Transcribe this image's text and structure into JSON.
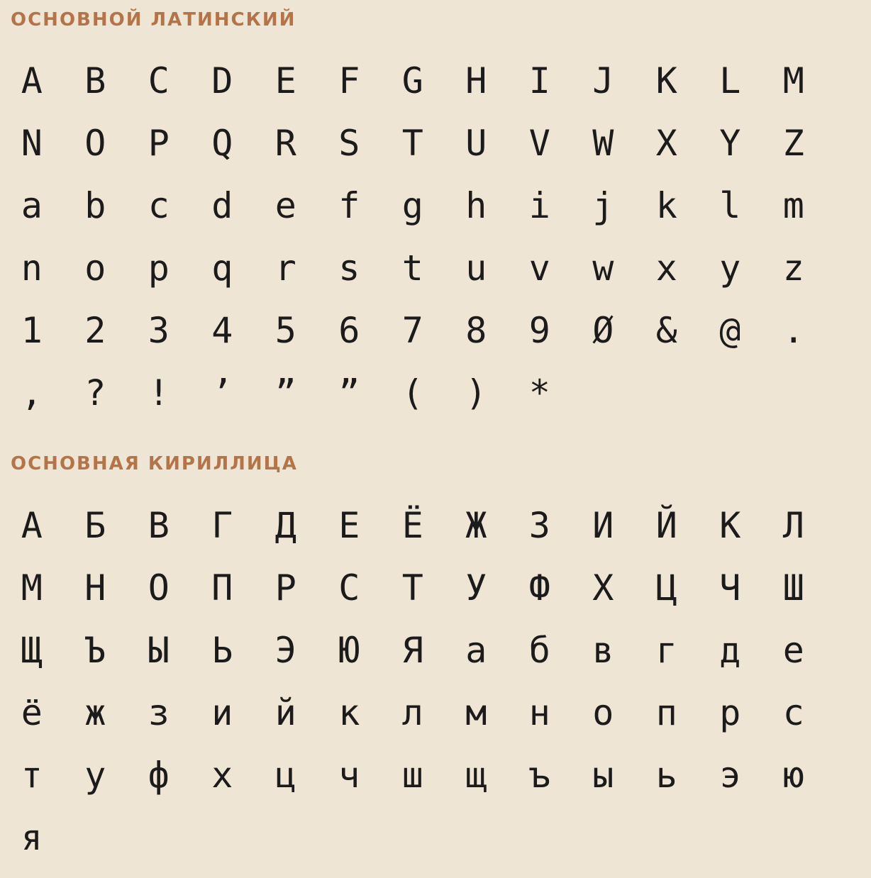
{
  "latin": {
    "title": "ОСНОВНОЙ ЛАТИНСКИЙ",
    "glyphs": [
      "A",
      "B",
      "C",
      "D",
      "E",
      "F",
      "G",
      "H",
      "I",
      "J",
      "K",
      "L",
      "M",
      "N",
      "O",
      "P",
      "Q",
      "R",
      "S",
      "T",
      "U",
      "V",
      "W",
      "X",
      "Y",
      "Z",
      "a",
      "b",
      "c",
      "d",
      "e",
      "f",
      "g",
      "h",
      "i",
      "j",
      "k",
      "l",
      "m",
      "n",
      "o",
      "p",
      "q",
      "r",
      "s",
      "t",
      "u",
      "v",
      "w",
      "x",
      "y",
      "z",
      "1",
      "2",
      "3",
      "4",
      "5",
      "6",
      "7",
      "8",
      "9",
      "Ø",
      "&",
      "@",
      ".",
      ",",
      "?",
      "!",
      "’",
      "”",
      "”",
      "(",
      ")",
      "*"
    ]
  },
  "cyrillic": {
    "title": "ОСНОВНАЯ КИРИЛЛИЦА",
    "glyphs": [
      "А",
      "Б",
      "В",
      "Г",
      "Д",
      "Е",
      "Ё",
      "Ж",
      "З",
      "И",
      "Й",
      "К",
      "Л",
      "М",
      "Н",
      "О",
      "П",
      "Р",
      "С",
      "Т",
      "У",
      "Ф",
      "Х",
      "Ц",
      "Ч",
      "Ш",
      "Щ",
      "Ъ",
      "Ы",
      "Ь",
      "Э",
      "Ю",
      "Я",
      "а",
      "б",
      "в",
      "г",
      "д",
      "е",
      "ё",
      "ж",
      "з",
      "и",
      "й",
      "к",
      "л",
      "м",
      "н",
      "о",
      "п",
      "р",
      "с",
      "т",
      "у",
      "ф",
      "х",
      "ц",
      "ч",
      "ш",
      "щ",
      "ъ",
      "ы",
      "ь",
      "э",
      "ю",
      "я"
    ]
  },
  "colors": {
    "background": "#EEE5D4",
    "title": "#B27448",
    "glyph": "#1B1B1B"
  }
}
